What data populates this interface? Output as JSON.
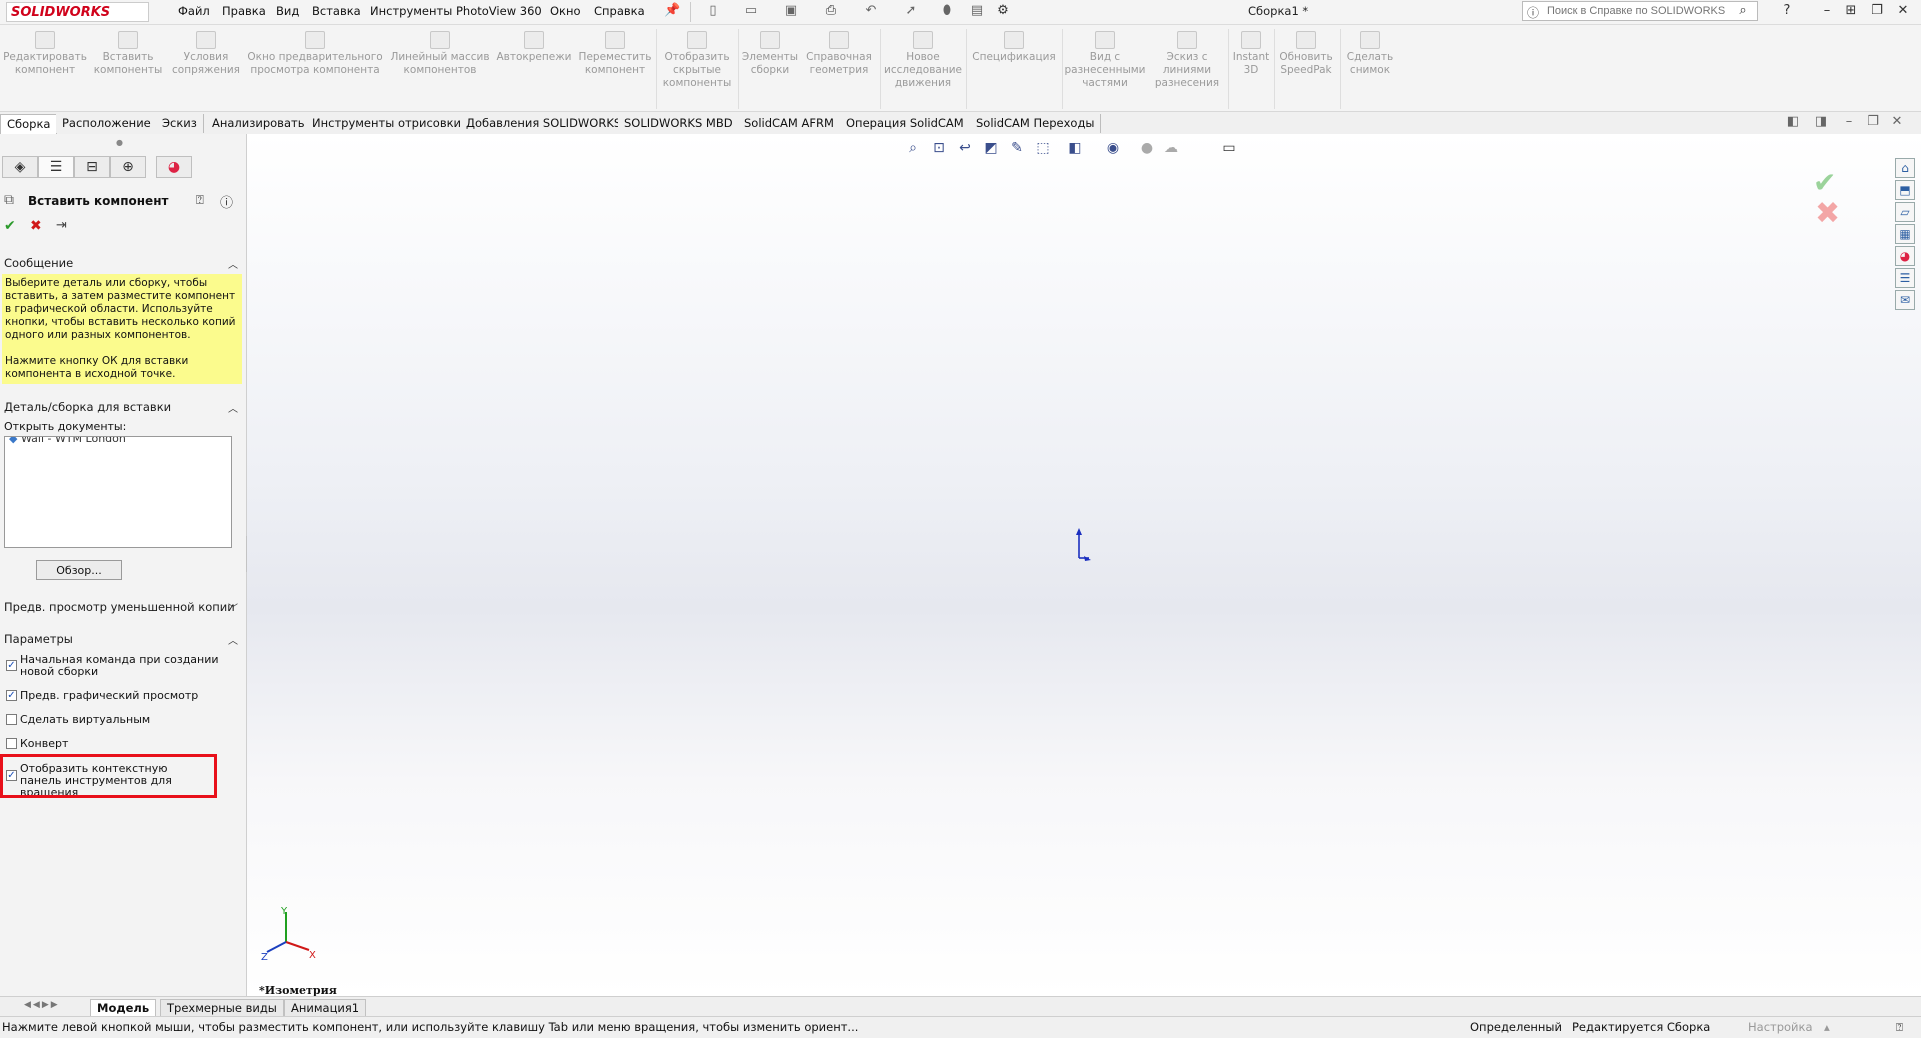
{
  "app": {
    "logo": "SOLIDWORKS",
    "document_title": "Сборка1 *"
  },
  "menu": [
    "Файл",
    "Правка",
    "Вид",
    "Вставка",
    "Инструменты",
    "PhotoView 360",
    "Окно",
    "Справка"
  ],
  "search": {
    "placeholder": "Поиск в Справке по SOLIDWORKS"
  },
  "commands": [
    "Редактировать компонент",
    "Вставить компоненты",
    "Условия сопряжения",
    "Окно предварительного просмотра компонента",
    "Линейный массив компонентов",
    "Автокрепежи",
    "Переместить компонент",
    "Отобразить скрытые компоненты",
    "Элементы сборки",
    "Справочная геометрия",
    "Новое исследование движения",
    "Спецификация",
    "Вид с разнесенными частями",
    "Эскиз с линиями разнесения",
    "Instant 3D",
    "Обновить SpeedPak",
    "Сделать снимок"
  ],
  "tabs": [
    "Сборка",
    "Расположение",
    "Эскиз",
    "Анализировать",
    "Инструменты отрисовки",
    "Добавления SOLIDWORKS",
    "SOLIDWORKS MBD",
    "SolidCAM AFRM",
    "Операция  SolidCAM",
    "SolidCAM Переходы"
  ],
  "property_manager": {
    "title": "Вставить компонент",
    "message_head": "Сообщение",
    "message_p1": "Выберите деталь или сборку, чтобы вставить, а затем разместите компонент в графической области. Используйте кнопки, чтобы вставить несколько копий одного или разных компонентов.",
    "message_p2": "Нажмите кнопку ОК для вставки компонента в исходной точке.",
    "part_head": "Деталь/сборка для вставки",
    "open_docs_label": "Открыть документы:",
    "open_doc_item": "Wall - WTM London",
    "browse_label": "Обзор...",
    "preview_head": "Предв. просмотр уменьшенной копии",
    "params_head": "Параметры",
    "options": [
      {
        "label": "Начальная команда при создании новой сборки",
        "checked": true
      },
      {
        "label": "Предв. графический просмотр",
        "checked": true
      },
      {
        "label": "Сделать виртуальным",
        "checked": false
      },
      {
        "label": "Конверт",
        "checked": false
      },
      {
        "label": "Отобразить контекстную панель инструментов для вращения",
        "checked": true
      }
    ],
    "highlight_color": "#e8101a"
  },
  "graphics": {
    "view_label": "*Изометрия",
    "triad": {
      "x": "X",
      "y": "Y",
      "z": "Z"
    }
  },
  "bottom_tabs": [
    "Модель",
    "Трехмерные виды",
    "Анимация1"
  ],
  "status": {
    "message": "Нажмите левой кнопкой мыши, чтобы разместить компонент, или используйте клавишу Tab или меню вращения, чтобы изменить ориент...",
    "defined": "Определенный",
    "editing": "Редактируется Сборка",
    "customize": "Настройка"
  }
}
